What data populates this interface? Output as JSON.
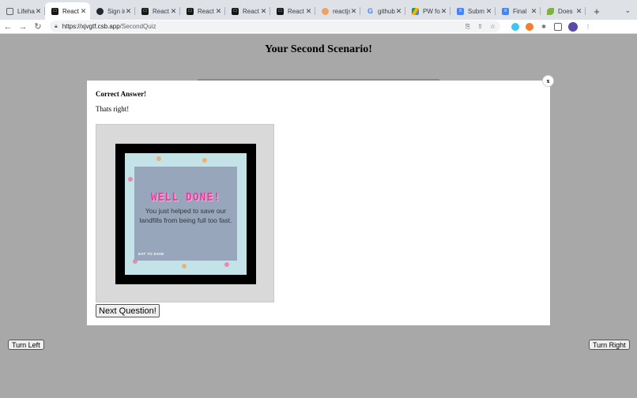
{
  "browser": {
    "tabs": [
      {
        "label": "Lifehac",
        "favicon": "page",
        "active": false
      },
      {
        "label": "React",
        "favicon": "codesandbox",
        "active": true
      },
      {
        "label": "Sign in",
        "favicon": "github",
        "active": false
      },
      {
        "label": "React",
        "favicon": "codesandbox",
        "active": false
      },
      {
        "label": "React",
        "favicon": "codesandbox",
        "active": false
      },
      {
        "label": "React",
        "favicon": "codesandbox",
        "active": false
      },
      {
        "label": "React",
        "favicon": "codesandbox",
        "active": false
      },
      {
        "label": "reactjs",
        "favicon": "figure",
        "active": false
      },
      {
        "label": "github",
        "favicon": "google",
        "active": false
      },
      {
        "label": "PW fo",
        "favicon": "drive",
        "active": false
      },
      {
        "label": "Subm",
        "favicon": "docs",
        "active": false
      },
      {
        "label": "Final",
        "favicon": "docs",
        "active": false
      },
      {
        "label": "Does",
        "favicon": "leaf",
        "active": false
      }
    ],
    "url_host": "https://xjvgtf.csb.app",
    "url_path": "/SecondQuiz"
  },
  "page": {
    "title": "Your Second Scenario!",
    "turn_left": "Turn Left",
    "turn_right": "Turn Right"
  },
  "modal": {
    "close_label": "x",
    "heading": "Correct Answer!",
    "message": "Thats right!",
    "image": {
      "headline": "WELL DONE!",
      "body": "You just helped to save our landfills from being full too fast.",
      "tag": "EAT TO SAVE"
    },
    "next_button": "Next Question!"
  },
  "colors": {
    "overlay": "#a8a8a8",
    "headline_pink": "#e040a0",
    "card_bg": "#98a6bb",
    "teal_bg": "#c3e3e8"
  }
}
